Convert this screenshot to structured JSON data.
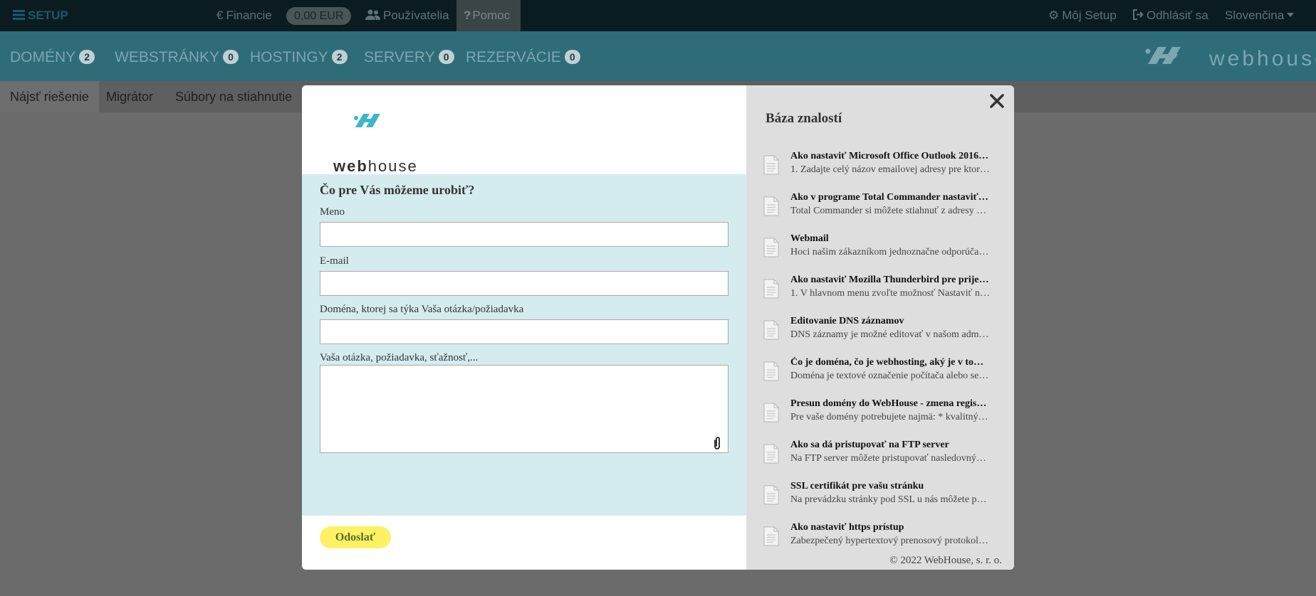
{
  "topbar": {
    "brand": "SETUP",
    "financie": "Financie",
    "balance": "0,00 EUR",
    "pouzivatelia": "Používatelia",
    "pomoc": "Pomoc",
    "moj_setup": "Môj Setup",
    "odhlasit": "Odhlásiť sa",
    "language": "Slovenčina"
  },
  "nav": {
    "items": [
      {
        "label": "DOMÉNY",
        "count": "2"
      },
      {
        "label": "WEBSTRÁNKY",
        "count": "0"
      },
      {
        "label": "HOSTINGY",
        "count": "2"
      },
      {
        "label": "SERVERY",
        "count": "0"
      },
      {
        "label": "REZERVÁCIE",
        "count": "0"
      }
    ],
    "logo_text": "webhouse"
  },
  "subnav": {
    "items": [
      "Nájsť riešenie",
      "Migrátor",
      "Súbory na stiahnutie"
    ]
  },
  "modal": {
    "logo_text": "webhouse",
    "heading": "Čo pre Vás môžeme urobiť?",
    "fields": {
      "name_label": "Meno",
      "name_value": "",
      "email_label": "E-mail",
      "email_value": "",
      "domain_label": "Doména, ktorej sa týka Vaša otázka/požiadavka",
      "domain_value": "",
      "message_label": "Vaša otázka, požiadavka, sťažnosť,...",
      "message_value": ""
    },
    "send_label": "Odoslať",
    "kb": {
      "title": "Báza znalostí",
      "articles": [
        {
          "title": "Ako nastaviť Microsoft Office Outlook 2016…",
          "desc": "1. Zadajte celý názov emailovej adresy pre ktor…"
        },
        {
          "title": "Ako v programe Total Commander nastaviť…",
          "desc": "Total Commander si môžete stiahnuť z adresy …"
        },
        {
          "title": "Webmail",
          "desc": "Hoci našim zákazníkom jednoznačne odporúča…"
        },
        {
          "title": "Ako nastaviť Mozilla Thunderbird pre prije…",
          "desc": "1. V hlavnom menu zvoľte možnosť Nastaviť n…"
        },
        {
          "title": "Editovanie DNS záznamov",
          "desc": "DNS záznamy je možné editovať v našom adm…"
        },
        {
          "title": "Čo je doména, čo je webhosting, aký je v to…",
          "desc": "Doména je textové označenie počítača alebo se…"
        },
        {
          "title": "Presun domény do WebHouse - zmena regis…",
          "desc": "Pre vaše domény potrebujete najmä: * kvalitný…"
        },
        {
          "title": "Ako sa dá pristupovať na FTP server",
          "desc": "Na FTP server môžete pristupovať nasledovný…"
        },
        {
          "title": "SSL certifikát pre vašu stránku",
          "desc": "Na prevádzku stránky pod SSL u nás môžete p…"
        },
        {
          "title": "Ako nastaviť https prístup",
          "desc": "Zabezpečený hypertextový prenosový protokol…"
        }
      ],
      "footer": "© 2022 WebHouse, s. r. o."
    }
  },
  "colors": {
    "topbar_bg": "#0b1c20",
    "navbar_bg": "#2e6c78",
    "form_bg": "#d5ecef",
    "kb_bg": "#dedede",
    "send_button": "#fff164"
  },
  "icons": [
    "menu-icon",
    "euro-icon",
    "users-icon",
    "question-icon",
    "gear-icon",
    "sign-out-icon",
    "caret-down-icon",
    "close-icon",
    "document-icon",
    "paperclip-icon"
  ]
}
